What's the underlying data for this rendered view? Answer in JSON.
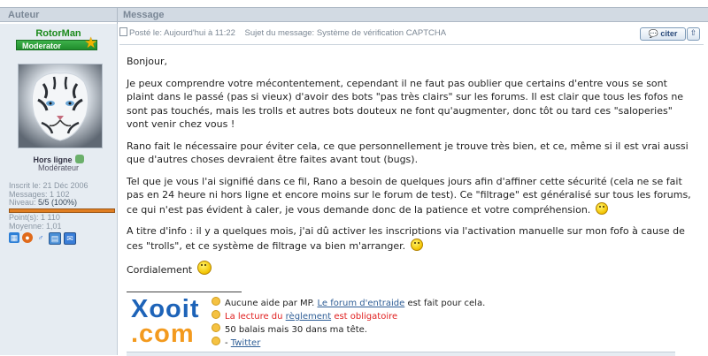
{
  "header": {
    "author_col": "Auteur",
    "message_col": "Message"
  },
  "author": {
    "name": "RotorMan",
    "rank": "Moderator",
    "status": "Hors ligne",
    "role": "Modérateur",
    "stats": {
      "registered": "Inscrit le: 21 Déc 2006",
      "messages": "Messages: 1 102",
      "level_label": "Niveau: ",
      "level_value": "5/5 (100%)",
      "points": "Point(s): 1 110",
      "average": "Moyenne: 1,01"
    },
    "level_fraction": 1.0,
    "icons": [
      "windows-icon",
      "firefox-icon",
      "male-icon",
      "profile-icon",
      "messenger-icon"
    ]
  },
  "post": {
    "posted_label": "Posté le: Aujourd'hui à 11:22",
    "subject_label": "Sujet du message: Système de vérification CAPTCHA",
    "quote_button": "citer",
    "top_button": "⇧",
    "greeting": "Bonjour,",
    "p1": "Je peux comprendre votre mécontentement, cependant il ne faut pas oublier que certains d'entre vous se sont plaint dans le passé (pas si vieux) d'avoir des bots \"pas très clairs\" sur les forums. Il est clair que tous les fofos ne sont pas touchés, mais les trolls et autres bots douteux ne font qu'augmenter, donc tôt ou tard ces \"saloperies\" vont venir chez vous !",
    "p2": "Rano fait le nécessaire pour éviter cela, ce que personnellement je trouve très bien, et ce, même si il est vrai aussi que d'autres choses devraient être faites avant tout (bugs).",
    "p3": "Tel que je vous l'ai signifié dans ce fil, Rano a besoin de quelques jours afin d'affiner cette sécurité (cela ne se fait pas en 24 heure ni hors ligne et encore moins sur le forum de test). Ce \"filtrage\" est généralisé sur tous les forums, ce qui n'est pas évident à caler, je vous demande donc de la patience et votre compréhension.",
    "p4": "A titre d'info : il y a quelques mois, j'ai dû activer les inscriptions via l'activation manuelle sur mon fofo à cause de ces \"trolls\", et ce système de filtrage va bien m'arranger.",
    "closing": "Cordialement"
  },
  "signature": {
    "logo_top": "Xooit",
    "logo_bottom": ".com",
    "line1_prefix": "Aucune aide par MP. ",
    "line1_link": "Le forum d'entraide",
    "line1_suffix": " est fait pour cela.",
    "line2_prefix": "La lecture du ",
    "line2_link": "règlement",
    "line2_suffix": " est obligatoire",
    "line3": "50 balais mais 30 dans ma tête.",
    "line4_prefix": "- ",
    "line4_link": "Twitter"
  },
  "colors": {
    "header_bg": "#d2dae3",
    "sidebar_bg": "#e6ecf2",
    "username": "#1b8a1b",
    "level_bar": "#e07e22",
    "link": "#2f5e96",
    "red": "#e02020"
  }
}
